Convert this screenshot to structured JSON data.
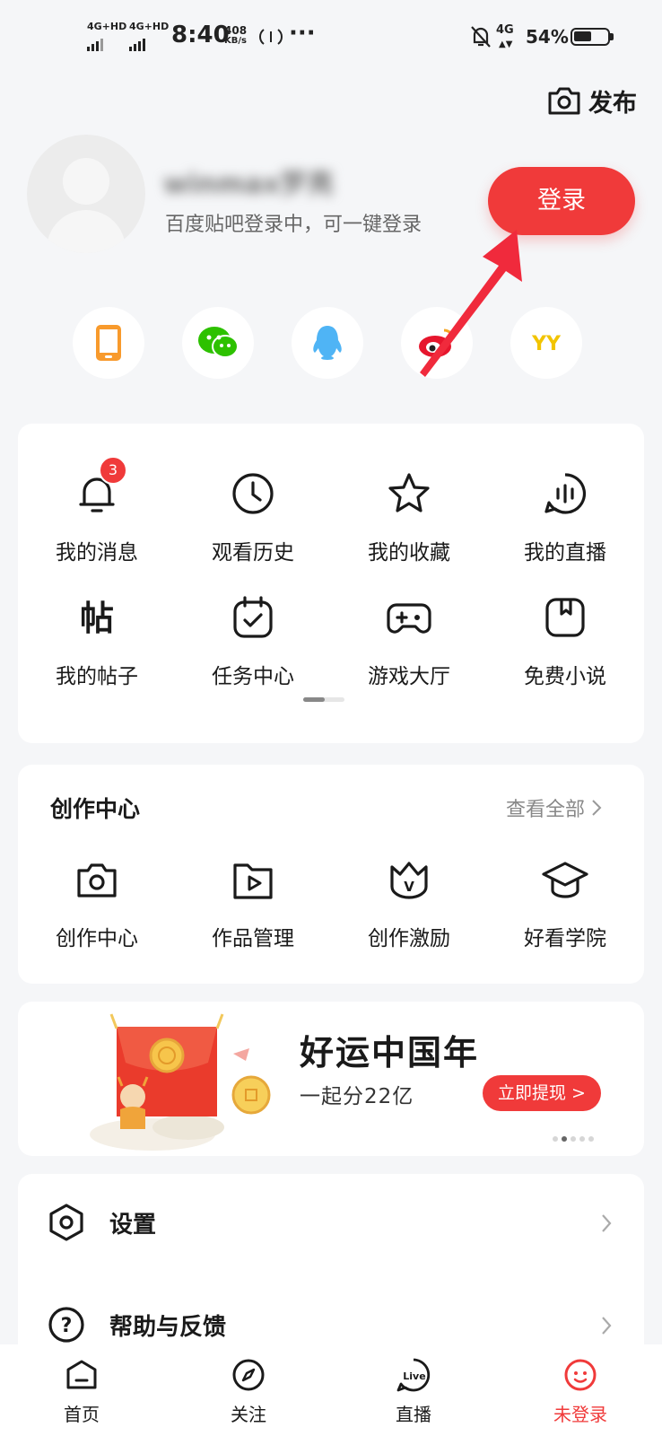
{
  "status_bar": {
    "net1": "4G+HD",
    "net2": "4G+HD",
    "time": "8:40",
    "speed_value": "408",
    "speed_unit": "KB/s",
    "dots": "···",
    "net3": "4G",
    "battery": "54%",
    "battery_level": 0.54
  },
  "header": {
    "publish_label": "发布"
  },
  "profile": {
    "username": "winmax罗亮",
    "login_hint": "百度贴吧登录中，可一键登录",
    "login_button": "登录"
  },
  "social": {
    "yy_label": "YY"
  },
  "quick_grid": {
    "items": [
      {
        "label": "我的消息",
        "icon": "bell-icon",
        "badge": "3"
      },
      {
        "label": "观看历史",
        "icon": "clock-icon"
      },
      {
        "label": "我的收藏",
        "icon": "star-icon"
      },
      {
        "label": "我的直播",
        "icon": "live-stream-icon"
      },
      {
        "label": "我的帖子",
        "icon": "post-icon",
        "glyph": "帖"
      },
      {
        "label": "任务中心",
        "icon": "task-calendar-icon"
      },
      {
        "label": "游戏大厅",
        "icon": "gamepad-icon"
      },
      {
        "label": "免费小说",
        "icon": "book-icon"
      }
    ],
    "page_index": 1,
    "page_count": 2
  },
  "creator": {
    "title": "创作中心",
    "view_all": "查看全部",
    "items": [
      {
        "label": "创作中心",
        "icon": "camera-icon"
      },
      {
        "label": "作品管理",
        "icon": "video-folder-icon"
      },
      {
        "label": "创作激励",
        "icon": "crown-icon",
        "glyph": "V"
      },
      {
        "label": "好看学院",
        "icon": "graduation-cap-icon"
      }
    ]
  },
  "banner": {
    "title": "好运中国年",
    "subtitle": "一起分22亿",
    "button": "立即提现 >",
    "page_index": 2,
    "page_count": 5
  },
  "settings_list": {
    "items": [
      {
        "label": "设置",
        "icon": "hexagon-settings-icon"
      },
      {
        "label": "帮助与反馈",
        "icon": "help-circle-icon",
        "glyph": "?"
      }
    ]
  },
  "tabbar": {
    "items": [
      {
        "label": "首页",
        "icon": "home-icon"
      },
      {
        "label": "关注",
        "icon": "compass-icon"
      },
      {
        "label": "直播",
        "icon": "live-icon",
        "glyph": "Live"
      },
      {
        "label": "未登录",
        "icon": "profile-icon"
      }
    ],
    "active_index": 3
  },
  "colors": {
    "accent": "#f03a3a",
    "background": "#f5f6f8",
    "card": "#ffffff",
    "arrow": "#f02a3c"
  }
}
